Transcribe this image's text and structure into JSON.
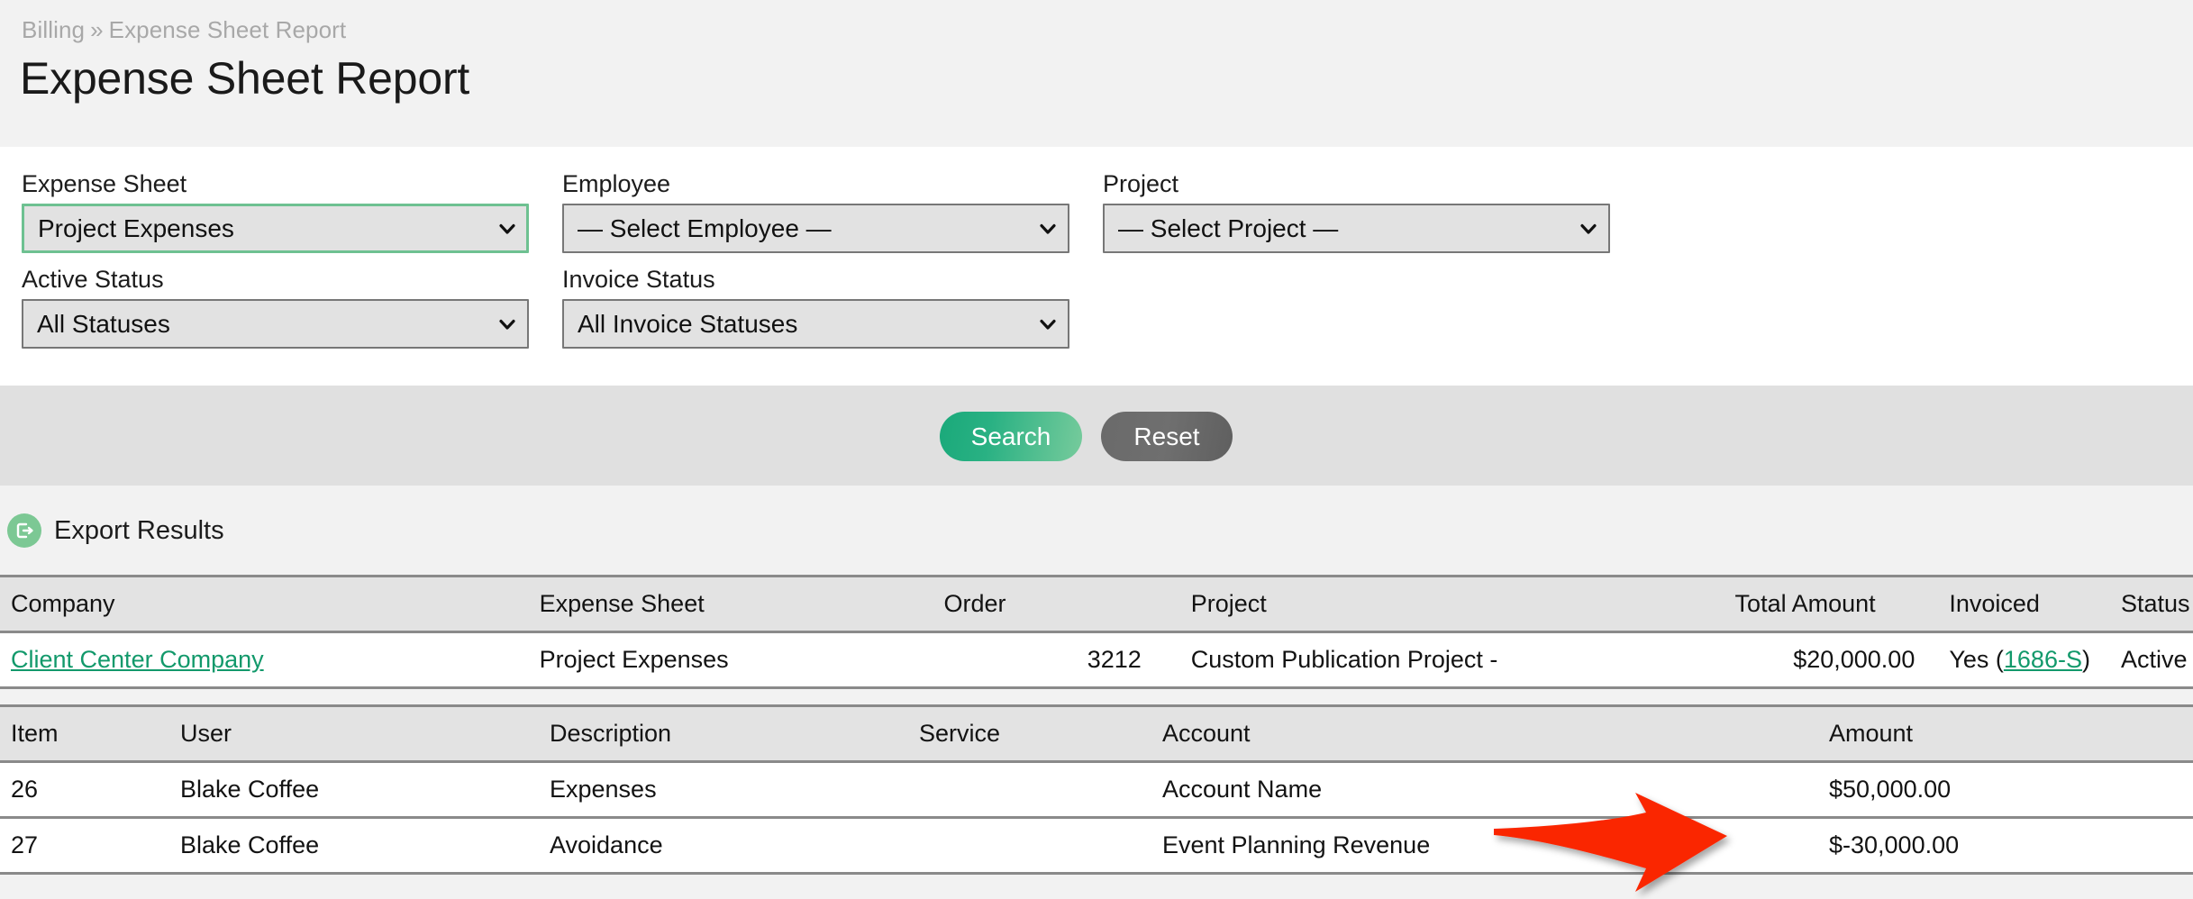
{
  "breadcrumb": {
    "parent": "Billing",
    "separator": "»",
    "current": "Expense Sheet Report"
  },
  "page_title": "Expense Sheet Report",
  "filters": {
    "fields": [
      {
        "label": "Expense Sheet",
        "value": "Project Expenses",
        "focused": true
      },
      {
        "label": "Employee",
        "value": "— Select Employee —",
        "focused": false
      },
      {
        "label": "Project",
        "value": "— Select Project —",
        "focused": false
      },
      {
        "label": "Active Status",
        "value": "All Statuses",
        "focused": false
      },
      {
        "label": "Invoice Status",
        "value": "All Invoice Statuses",
        "focused": false
      }
    ]
  },
  "actions": {
    "search_label": "Search",
    "reset_label": "Reset"
  },
  "export": {
    "icon": "export-icon",
    "label": "Export Results"
  },
  "results_table": {
    "headers": [
      "Company",
      "Expense Sheet",
      "Order",
      "Project",
      "Total Amount",
      "Invoiced",
      "Status"
    ],
    "row": {
      "company": "Client Center Company",
      "expense_sheet": "Project Expenses",
      "order": "3212",
      "project": "Custom Publication Project -",
      "total_amount": "$20,000.00",
      "invoiced_prefix": "Yes (",
      "invoiced_link": "1686-S",
      "invoiced_suffix": ")",
      "status": "Active"
    }
  },
  "line_items_table": {
    "headers": [
      "Item",
      "User",
      "Description",
      "Service",
      "Account",
      "Amount"
    ],
    "rows": [
      {
        "item": "26",
        "user": "Blake Coffee",
        "description": "Expenses",
        "service": "",
        "account": "Account Name",
        "amount": "$50,000.00"
      },
      {
        "item": "27",
        "user": "Blake Coffee",
        "description": "Avoidance",
        "service": "",
        "account": "Event Planning Revenue",
        "amount": "$-30,000.00"
      }
    ]
  },
  "annotation": {
    "type": "arrow",
    "direction": "right",
    "color": "#fa2600",
    "points_at": "$-30,000.00"
  },
  "colors": {
    "page_bg": "#f2f2f2",
    "panel_bg": "#ffffff",
    "button_bar_bg": "#e0e0e0",
    "accent_green": "#1aa97a",
    "focus_green": "#6ec191",
    "link_green": "#12996b",
    "annotation_red": "#fa2600",
    "table_header_bg": "#e3e3e3",
    "table_border": "#8a8a8a"
  }
}
